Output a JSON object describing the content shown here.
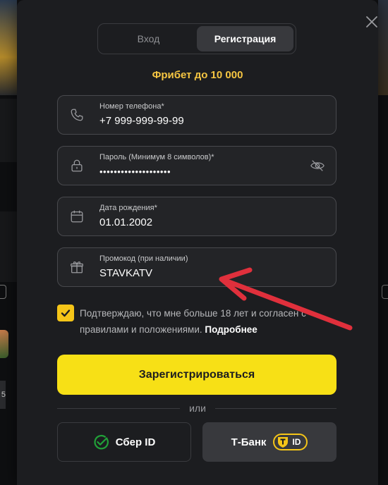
{
  "tabs": {
    "login": "Вход",
    "register": "Регистрация"
  },
  "bonus": "Фрибет до 10 000",
  "fields": {
    "phone": {
      "label": "Номер телефона*",
      "value": "+7 999-999-99-99"
    },
    "password": {
      "label": "Пароль (Минимум 8 символов)*",
      "value": "••••••••••••••••••••"
    },
    "birthdate": {
      "label": "Дата рождения*",
      "value": "01.01.2002"
    },
    "promo": {
      "label": "Промокод (при наличии)",
      "value": "STAVKATV"
    }
  },
  "agree": {
    "text": "Подтверждаю, что мне больше 18 лет и согласен с правилами и положениями.",
    "link": "Подробнее",
    "checked": true
  },
  "submit_label": "Зарегистрироваться",
  "or_label": "или",
  "social": {
    "sber": "Сбер ID",
    "tbank": "Т-Банк",
    "tbank_badge": "ID"
  },
  "background_left_number": "5",
  "colors": {
    "accent": "#f7e016",
    "bonus": "#f5c542",
    "annotation_arrow": "#e0303c"
  }
}
